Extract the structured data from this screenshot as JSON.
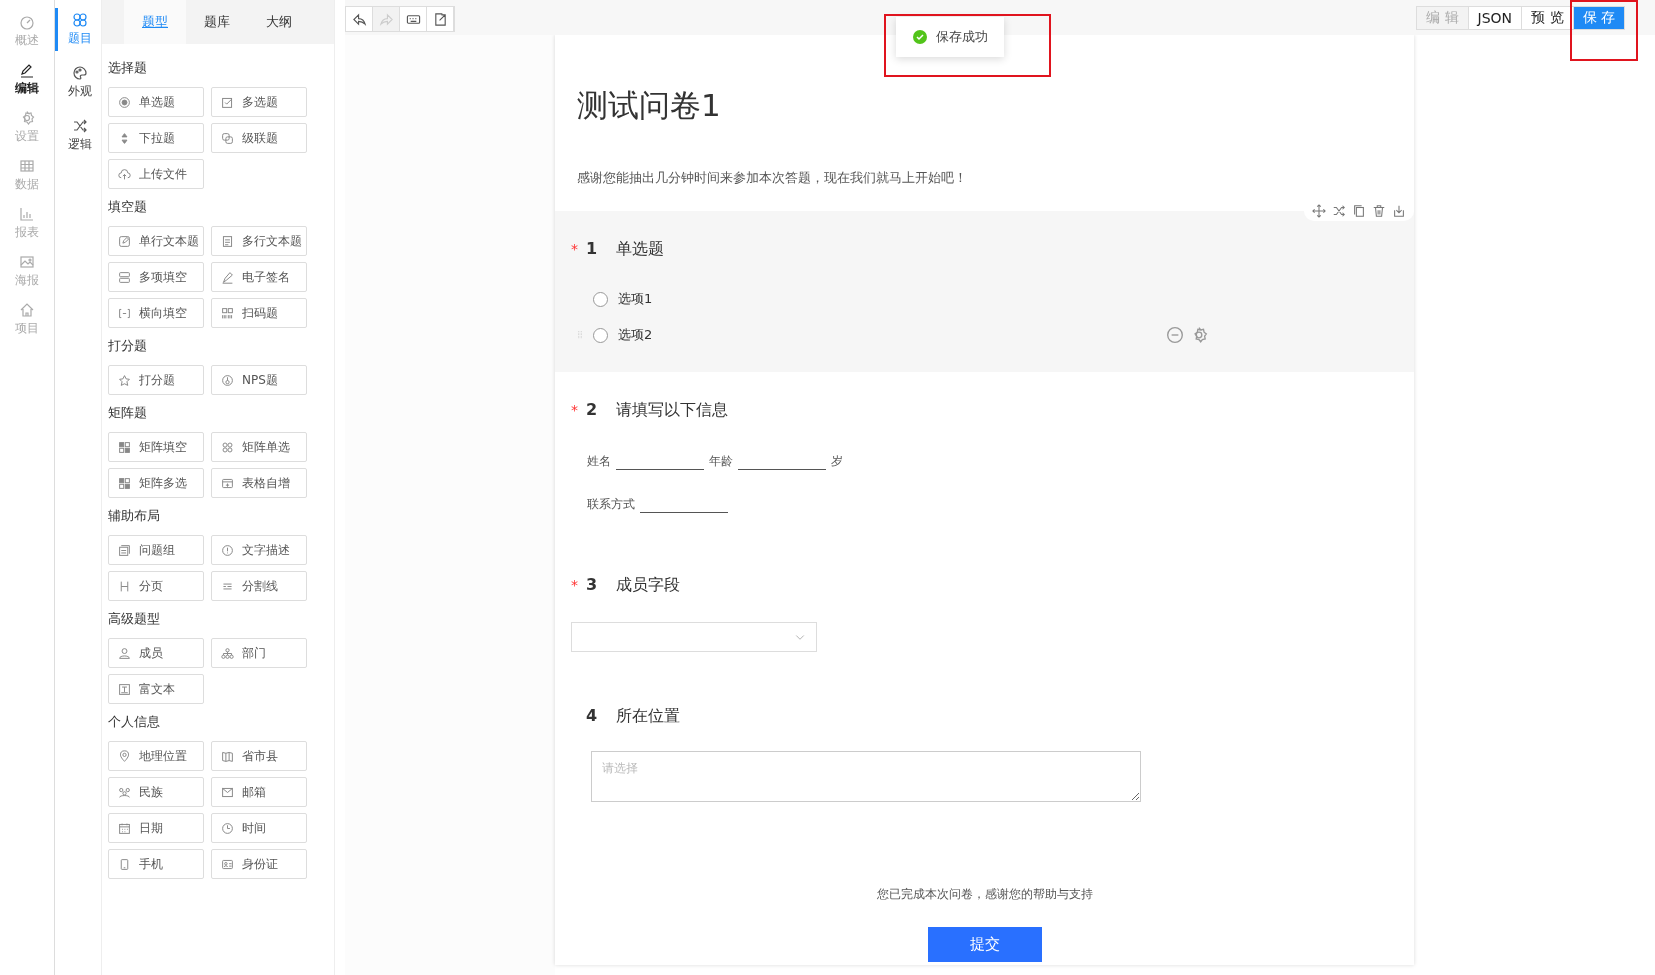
{
  "rail": [
    {
      "label": "概述",
      "selected": false
    },
    {
      "label": "编辑",
      "selected": true
    },
    {
      "label": "设置",
      "selected": false
    },
    {
      "label": "数据",
      "selected": false
    },
    {
      "label": "报表",
      "selected": false
    },
    {
      "label": "海报",
      "selected": false
    },
    {
      "label": "项目",
      "selected": false
    }
  ],
  "subrail": [
    {
      "label": "题目",
      "selected": true
    },
    {
      "label": "外观",
      "selected": false
    },
    {
      "label": "逻辑",
      "selected": false
    }
  ],
  "panel_tabs": [
    {
      "label": "题型",
      "selected": true
    },
    {
      "label": "题库",
      "selected": false
    },
    {
      "label": "大纲",
      "selected": false
    }
  ],
  "groups": [
    {
      "title": "选择题",
      "items": [
        "单选题",
        "多选题",
        "下拉题",
        "级联题",
        "上传文件"
      ]
    },
    {
      "title": "填空题",
      "items": [
        "单行文本题",
        "多行文本题",
        "多项填空",
        "电子签名",
        "横向填空",
        "扫码题"
      ]
    },
    {
      "title": "打分题",
      "items": [
        "打分题",
        "NPS题"
      ]
    },
    {
      "title": "矩阵题",
      "items": [
        "矩阵填空",
        "矩阵单选",
        "矩阵多选",
        "表格自增"
      ]
    },
    {
      "title": "辅助布局",
      "items": [
        "问题组",
        "文字描述",
        "分页",
        "分割线"
      ]
    },
    {
      "title": "高级题型",
      "items": [
        "成员",
        "部门",
        "富文本"
      ]
    },
    {
      "title": "个人信息",
      "items": [
        "地理位置",
        "省市县",
        "民族",
        "邮箱",
        "日期",
        "时间",
        "手机",
        "身份证"
      ]
    }
  ],
  "toolbar": [
    {
      "disabled": false
    },
    {
      "disabled": true
    },
    {
      "disabled": false
    },
    {
      "disabled": false
    }
  ],
  "actions": [
    {
      "label": "编 辑",
      "kind": "disabled"
    },
    {
      "label": "JSON",
      "kind": "default"
    },
    {
      "label": "预 览",
      "kind": "default"
    },
    {
      "label": "保 存",
      "kind": "primary"
    }
  ],
  "toast": {
    "text": "保存成功"
  },
  "survey": {
    "title": "测试问卷1",
    "description": "感谢您能抽出几分钟时间来参加本次答题，现在我们就马上开始吧！",
    "questions": [
      {
        "kind": "radio",
        "number": "1",
        "title": "单选题",
        "required_mark": "*",
        "selected": true,
        "options": [
          {
            "label": "选项1",
            "checked": false,
            "hovered": false
          },
          {
            "label": "选项2",
            "checked": false,
            "hovered": true
          }
        ]
      },
      {
        "kind": "fill",
        "number": "2",
        "title": "请填写以下信息",
        "required_mark": "*",
        "selected": false,
        "lines": [
          [
            {
              "kind": "text",
              "text": "姓名"
            },
            {
              "kind": "blank"
            },
            {
              "kind": "text",
              "text": "年龄"
            },
            {
              "kind": "blank"
            },
            {
              "kind": "text",
              "text": "岁"
            }
          ],
          [
            {
              "kind": "text",
              "text": "联系方式"
            },
            {
              "kind": "blank"
            }
          ]
        ]
      },
      {
        "kind": "select",
        "number": "3",
        "title": "成员字段",
        "required_mark": "*",
        "selected": false
      },
      {
        "kind": "textarea",
        "number": "4",
        "title": "所在位置",
        "selected": false,
        "placeholder": "请选择"
      }
    ],
    "closing": "您已完成本次问卷，感谢您的帮助与支持",
    "submit": "提交"
  }
}
